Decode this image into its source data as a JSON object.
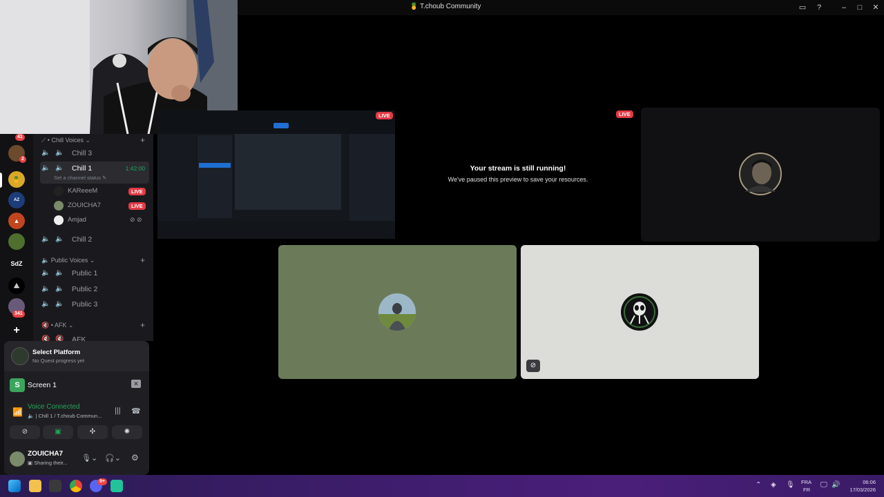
{
  "window": {
    "title": "T.choub Community"
  },
  "server_rail": {
    "badge_top": "41",
    "badge_second": "2",
    "sdz_label": "SdZ",
    "badge_bottom": "341",
    "add_label": "+"
  },
  "channels": {
    "category_chill": "Chill Voices",
    "chill3": "Chill 3",
    "chill1": "Chill 1",
    "chill1_timer": "1:42:00",
    "channel_status_placeholder": "Set a channel status",
    "members": [
      {
        "name": "KAReeeM",
        "live": "LIVE"
      },
      {
        "name": "ZOUICHA7",
        "live": "LIVE"
      },
      {
        "name": "Amjad"
      }
    ],
    "chill2": "Chill 2",
    "category_public": "Public Voices",
    "public1": "Public 1",
    "public2": "Public 2",
    "public3": "Public 3",
    "category_afk": "AFK",
    "afk_channel": "AFK"
  },
  "user_panel": {
    "quest_title": "Select Platform",
    "quest_sub": "No Quest progress yet",
    "screen_label": "Screen 1",
    "screen_icon_letter": "S",
    "voice_status": "Voice Connected",
    "voice_location": "Chill 1 / T.choub Commun...",
    "username": "ZOUICHA7",
    "user_status": "Sharing their..."
  },
  "stream": {
    "live_label": "LIVE",
    "paused_title": "Your stream is still running!",
    "paused_sub": "We've paused this preview to save your resources."
  },
  "taskbar": {
    "lang_top": "FRA",
    "lang_bottom": "FR",
    "time": "06:06",
    "date": "17/03/2026",
    "discord_badge": "9+"
  },
  "colors": {
    "accent_live": "#e13b45",
    "voice_green": "#23a55a",
    "discord_blurple": "#5865f2"
  }
}
